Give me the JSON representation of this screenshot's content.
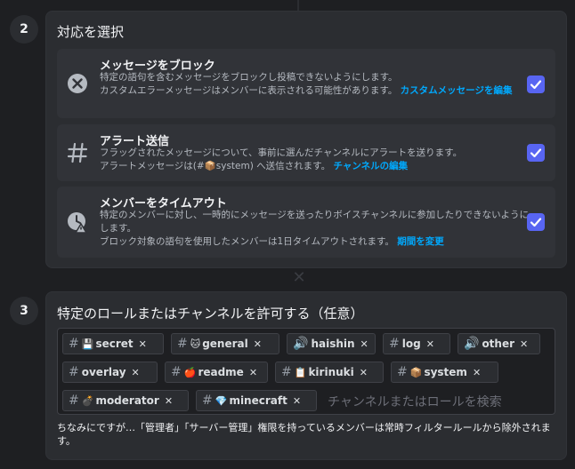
{
  "step2": {
    "number": "2",
    "title": "対応を選択",
    "actions": [
      {
        "title": "メッセージをブロック",
        "desc_line1": "特定の語句を含むメッセージをブロックし投稿できないようにします。",
        "desc_line2": "カスタムエラーメッセージはメンバーに表示される可能性があります。",
        "link": "カスタムメッセージを編集",
        "icon": "circle-x-icon",
        "checked": true
      },
      {
        "title": "アラート送信",
        "desc_line1": "フラッグされたメッセージについて、事前に選んだチャンネルにアラートを送ります。",
        "desc_line2": "アラートメッセージは(#📦system) へ送信されます。",
        "link": "チャンネルの編集",
        "icon": "hash-icon",
        "checked": true
      },
      {
        "title": "メンバーをタイムアウト",
        "desc_line1": "特定のメンバーに対し、一時的にメッセージを送ったりボイスチャンネルに参加したりできないようにします。",
        "desc_line2": "ブロック対象の語句を使用したメンバーは1日タイムアウトされます。",
        "link": "期間を変更",
        "icon": "timeout-clock-icon",
        "checked": true
      }
    ]
  },
  "step3": {
    "number": "3",
    "title": "特定のロールまたはチャンネルを許可する（任意）",
    "chips": [
      {
        "prefix": "#",
        "emoji": "💾",
        "label": "secret"
      },
      {
        "prefix": "#",
        "emoji": "🐱",
        "label": "general"
      },
      {
        "prefix": "🔊",
        "emoji": "",
        "label": "haishin"
      },
      {
        "prefix": "#",
        "emoji": "",
        "label": "log"
      },
      {
        "prefix": "🔊",
        "emoji": "",
        "label": "other"
      },
      {
        "prefix": "#",
        "emoji": "",
        "label": "overlay"
      },
      {
        "prefix": "#",
        "emoji": "🍎",
        "label": "readme"
      },
      {
        "prefix": "#",
        "emoji": "📋",
        "label": "kirinuki"
      },
      {
        "prefix": "#",
        "emoji": "📦",
        "label": "system"
      },
      {
        "prefix": "#",
        "emoji": "💣",
        "label": "moderator"
      },
      {
        "prefix": "#",
        "emoji": "💎",
        "label": "minecraft"
      }
    ],
    "remove_glyph": "✕",
    "search_placeholder": "チャンネルまたはロールを検索",
    "note": "ちなみにですが…「管理者」「サーバー管理」権限を持っているメンバーは常時フィルタールールから除外されます。"
  },
  "colors": {
    "background": "#1e1f22",
    "panel": "#2b2d31",
    "card": "#313338",
    "accent": "#5865f2",
    "link": "#00a8fc"
  }
}
